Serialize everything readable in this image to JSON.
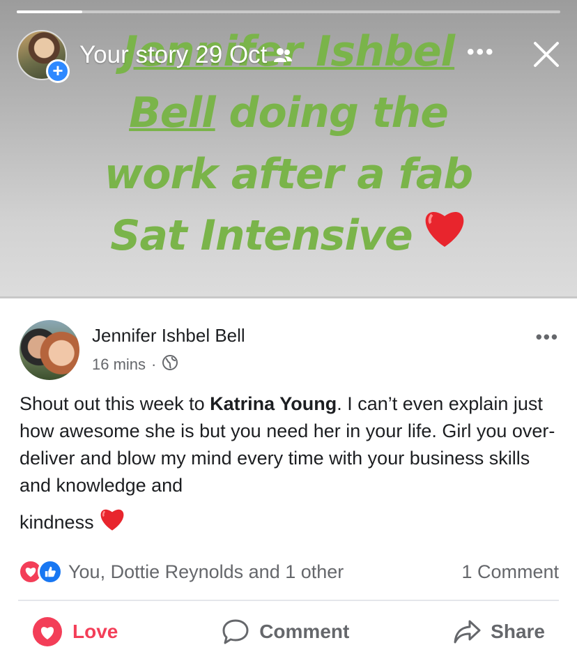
{
  "story": {
    "progress_fraction": 0.12,
    "author": "Your story",
    "date": "29 Oct",
    "overlay_lines": [
      "Jennifer Ishbel",
      "Bell doing the",
      "work after a fab",
      "Sat Intensive"
    ],
    "icons": {
      "friends": "friends-icon",
      "more": "more-dots-icon",
      "close": "close-icon",
      "add": "plus-icon",
      "heart": "heart-icon"
    },
    "more_label": "•••"
  },
  "post": {
    "author": "Jennifer Ishbel Bell",
    "time": "16 mins",
    "separator": "·",
    "more_label": "•••",
    "text_before": "Shout out this week to ",
    "tagged": "Katrina Young",
    "text_after": ". I can’t even explain just how awesome she is but you need her in your life. Girl you over-deliver and blow my mind every time with your business skills and knowledge and",
    "text_last": "kindness",
    "reactions_text": "You, Dottie Reynolds and 1 other",
    "comments_text": "1 Comment"
  },
  "actions": {
    "love": "Love",
    "comment": "Comment",
    "share": "Share"
  },
  "colors": {
    "overlay_text": "#7ab44a",
    "love": "#f33e58",
    "like": "#1877f2",
    "meta": "#65676b"
  }
}
